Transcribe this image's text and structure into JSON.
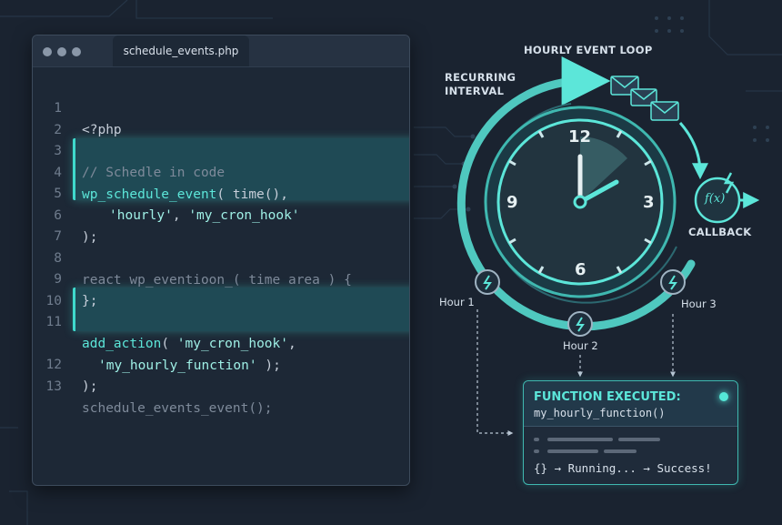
{
  "editor": {
    "tab_label": "schedule_events.php",
    "lines": [
      {
        "n": "1",
        "text": "<?php"
      },
      {
        "n": "2",
        "text": ""
      },
      {
        "n": "3",
        "text": "// Schedle in code"
      },
      {
        "n": "4",
        "text_parts": [
          "wp_schedule_event",
          "( time(),"
        ]
      },
      {
        "n": "5",
        "text_parts": [
          "'hourly'",
          ", ",
          "'my_cron_hook'"
        ]
      },
      {
        "n": "6",
        "text": ");"
      },
      {
        "n": "7",
        "text": ""
      },
      {
        "n": "8",
        "text": "react wp_eventioon_( time area ) {"
      },
      {
        "n": "9",
        "text": "};"
      },
      {
        "n": "10",
        "text": ""
      },
      {
        "n": "11",
        "text_parts": [
          "add_action",
          "( ",
          "'my_cron_hook'",
          ","
        ]
      },
      {
        "n": "",
        "text_parts": [
          "'my_hourly_function'",
          " );"
        ]
      },
      {
        "n": "12",
        "text": ");"
      },
      {
        "n": "13",
        "text": "schedule_events_event();"
      }
    ]
  },
  "diagram": {
    "loop_title": "HOURLY EVENT LOOP",
    "interval_label_1": "RECURRING",
    "interval_label_2": "INTERVAL",
    "callback_label": "CALLBACK",
    "callback_icon_text": "f(x)",
    "clock_numbers": [
      "12",
      "3",
      "6",
      "9"
    ],
    "hours": [
      "Hour 1",
      "Hour 2",
      "Hour 3"
    ]
  },
  "output": {
    "title": "FUNCTION EXECUTED:",
    "function_name": "my_hourly_function()",
    "status": "{} → Running... → Success!"
  },
  "colors": {
    "accent": "#3fd9cc",
    "background": "#1a2330"
  }
}
